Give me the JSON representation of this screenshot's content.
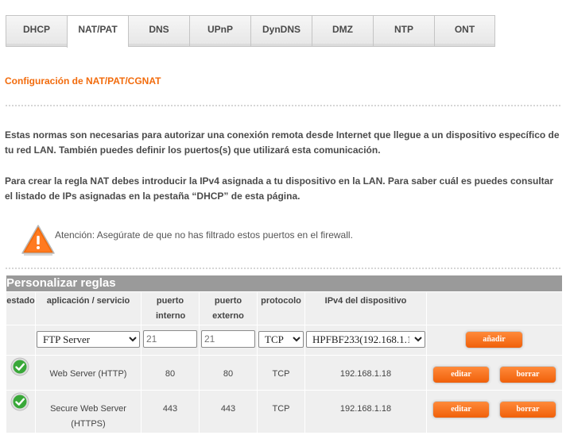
{
  "tabs": [
    {
      "label": "DHCP"
    },
    {
      "label": "NAT/PAT"
    },
    {
      "label": "DNS"
    },
    {
      "label": "UPnP"
    },
    {
      "label": "DynDNS"
    },
    {
      "label": "DMZ"
    },
    {
      "label": "NTP"
    },
    {
      "label": "ONT"
    }
  ],
  "active_tab": "NAT/PAT",
  "section_title": "Configuración de NAT/PAT/CGNAT",
  "intro": {
    "p1": "Estas normas son necesarias para autorizar una conexión remota desde Internet que llegue a un dispositivo específico de tu red LAN. También puedes definir los puertos(s) que utilizará esta comunicación.",
    "p2": "Para crear la regla NAT debes introducir la IPv4 asignada a tu dispositivo en la LAN. Para saber cuál es puedes consultar el listado de IPs asignadas en la pestaña “DHCP” de esta página."
  },
  "warning": {
    "text": "Atención: Asegúrate de que no has filtrado estos puertos en el firewall.",
    "icon": "warning-triangle-icon"
  },
  "table": {
    "title": "Personalizar reglas",
    "headers": {
      "estado": "estado",
      "aplicacion": "aplicación / servicio",
      "puerto_interno": "puerto interno",
      "puerto_externo": "puerto externo",
      "protocolo": "protocolo",
      "ipv4": "IPv4 del dispositivo"
    },
    "new_rule": {
      "service": "FTP Server",
      "internal_port_placeholder": "21",
      "external_port_placeholder": "21",
      "protocol": "TCP",
      "device": "HPFBF233(192.168.1.1",
      "add_label": "añadir"
    },
    "rows": [
      {
        "status_icon": "check-icon",
        "service": "Web Server (HTTP)",
        "internal": "80",
        "external": "80",
        "protocol": "TCP",
        "ip": "192.168.1.18"
      },
      {
        "status_icon": "check-icon",
        "service": "Secure Web Server (HTTPS)",
        "internal": "443",
        "external": "443",
        "protocol": "TCP",
        "ip": "192.168.1.18"
      }
    ],
    "edit_label": "editar",
    "delete_label": "borrar"
  },
  "colors": {
    "accent": "#f26b0c",
    "button": "#f0600a",
    "table_head": "#9a9a9a",
    "cell_bg": "#efefef"
  }
}
